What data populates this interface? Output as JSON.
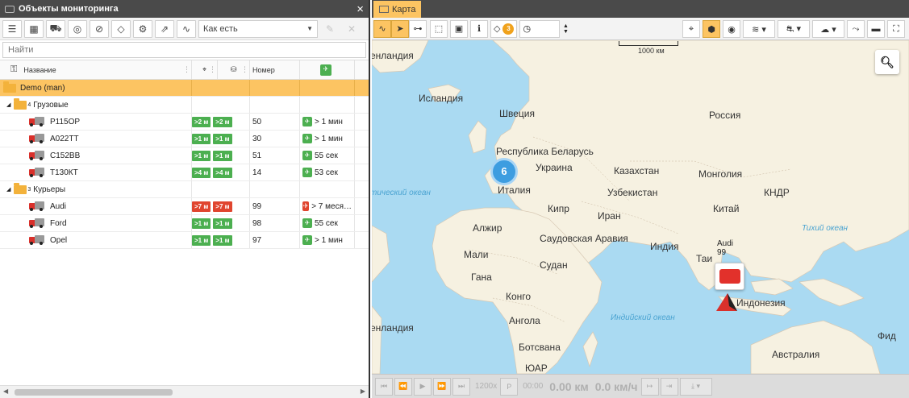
{
  "left_panel": {
    "title": "Объекты мониторинга",
    "close": "×",
    "dropdown_value": "Как есть",
    "search_placeholder": "Найти",
    "columns": {
      "name": "Название",
      "number": "Номер"
    },
    "root": "Demo (man)",
    "groups": [
      {
        "name": "Грузовые",
        "count": "4",
        "items": [
          {
            "name": "Р115ОР",
            "b1": ">2 м",
            "b2": ">2 м",
            "b_color": "green",
            "num": "50",
            "conn": "> 1 мин",
            "conn_color": "green"
          },
          {
            "name": "А022ТТ",
            "b1": ">1 м",
            "b2": ">1 м",
            "b_color": "green",
            "num": "30",
            "conn": "> 1 мин",
            "conn_color": "green"
          },
          {
            "name": "С152ВВ",
            "b1": ">1 м",
            "b2": ">1 м",
            "b_color": "green",
            "num": "51",
            "conn": "55 сек",
            "conn_color": "green"
          },
          {
            "name": "Т130КТ",
            "b1": ">4 м",
            "b2": ">4 м",
            "b_color": "green",
            "num": "14",
            "conn": "53 сек",
            "conn_color": "green"
          }
        ]
      },
      {
        "name": "Курьеры",
        "count": "3",
        "items": [
          {
            "name": "Audi",
            "b1": ">7 м",
            "b2": ">7 м",
            "b_color": "red",
            "num": "99",
            "conn": "> 7 меся…",
            "conn_color": "red"
          },
          {
            "name": "Ford",
            "b1": ">1 м",
            "b2": ">1 м",
            "b_color": "green",
            "num": "98",
            "conn": "55 сек",
            "conn_color": "green"
          },
          {
            "name": "Opel",
            "b1": ">1 м",
            "b2": ">1 м",
            "b_color": "green",
            "num": "97",
            "conn": "> 1 мин",
            "conn_color": "green"
          }
        ]
      }
    ]
  },
  "map_panel": {
    "tab": "Карта",
    "badge_count": "3",
    "scale_label": "1000 км",
    "cluster_count": "6",
    "unit_label": "Audi",
    "unit_number": "99",
    "labels": {
      "greenland": "енландия",
      "iceland": "Исландия",
      "sweden": "Швеция",
      "russia": "Россия",
      "belarus": "Республика Беларусь",
      "ukraine": "Украина",
      "kazakhstan": "Казахстан",
      "mongolia": "Монголия",
      "italy": "Италия",
      "uzbekistan": "Узбекистан",
      "china": "Китай",
      "prc": "КНДР",
      "atlantic": "тический океан",
      "cyprus": "Кипр",
      "iran": "Иран",
      "algeria": "Алжир",
      "saudi": "Саудовская Аравия",
      "india": "Индия",
      "pacific": "Тихий океан",
      "mali": "Мали",
      "sudan": "Судан",
      "thailand": "Таи",
      "ghana": "Гана",
      "congo": "Конго",
      "indonesia": "Индонезия",
      "indian_ocean": "Индийский океан",
      "angola": "Ангола",
      "fiji": "Фид",
      "botswana": "Ботсвана",
      "australia": "Австралия",
      "sar": "ЮАР"
    },
    "player": {
      "speed": "1200x",
      "p": "P",
      "time": "00:00",
      "dist": "0.00 км",
      "vel": "0.0 км/ч"
    }
  },
  "colors": {
    "accent": "#fcc462",
    "green": "#4caf50",
    "red": "#e0452f",
    "water": "#aadaf2",
    "land": "#f6f1e1"
  }
}
